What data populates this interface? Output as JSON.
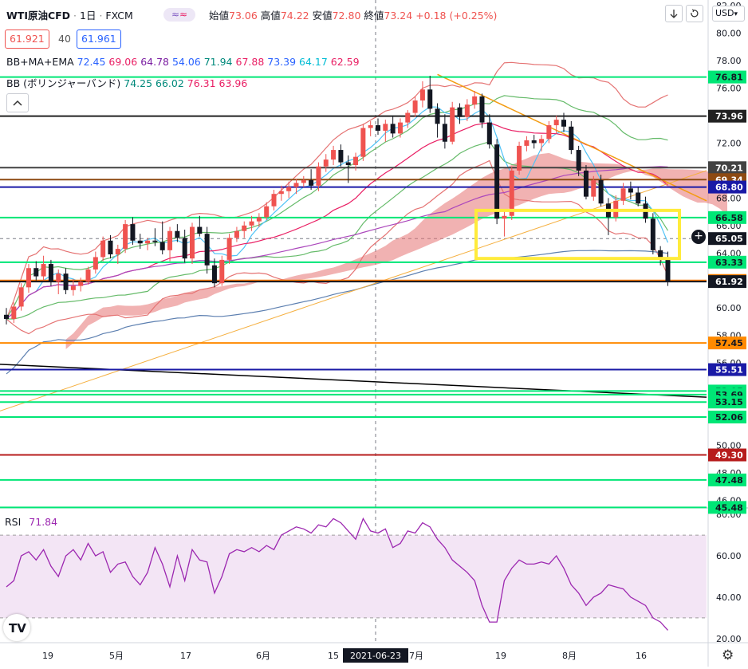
{
  "header": {
    "symbol": "WTI原油CFD",
    "interval": "1日",
    "source": "FXCM",
    "ohlc_labels": [
      "始値",
      "高値",
      "安値",
      "終値"
    ],
    "ohlc_values": [
      "73.06",
      "74.22",
      "72.80",
      "73.24"
    ],
    "change": "+0.18 (+0.25%)",
    "bid": "61.921",
    "spread": "40",
    "ask": "61.961",
    "currency": "USD"
  },
  "indicators": {
    "bbmaema_name": "BB+MA+EMA",
    "bbmaema_values": [
      "72.45",
      "69.06",
      "64.78",
      "54.06",
      "71.94",
      "67.88",
      "73.39",
      "64.17",
      "62.59"
    ],
    "bbmaema_colors": [
      "#2962ff",
      "#e91e63",
      "#7b1fa2",
      "#2962ff",
      "#00897b",
      "#e91e63",
      "#2962ff",
      "#00bcd4",
      "#e91e63"
    ],
    "bb_name": "BB (ボリンジャーバンド)",
    "bb_values": [
      "74.25",
      "66.02",
      "76.31",
      "63.96"
    ],
    "bb_colors": [
      "#00897b",
      "#00897b",
      "#e91e63",
      "#e91e63"
    ],
    "rsi_name": "RSI",
    "rsi_value": "71.84"
  },
  "colors": {
    "up": "#ef5350",
    "down": "#131722",
    "cloud": "#e57373",
    "cloud_dark": "#546e7a",
    "rsi_line": "#9c27b0",
    "rsi_band": "#f3e5f5",
    "highlight": "#ffeb3b"
  },
  "icons": [
    "collapse-icon",
    "scroll-down-icon",
    "fullscreen-icon",
    "settings-icon",
    "tradingview-logo",
    "crosshair-plus-icon"
  ],
  "chart_data": [
    {
      "type": "candlestick",
      "x_axis": {
        "tick_labels": [
          "19",
          "5月",
          "17",
          "6月",
          "15",
          "7月",
          "19",
          "8月",
          "16"
        ],
        "highlighted_date": "2021-06-23"
      },
      "y_axis": {
        "side": "right",
        "ylim": [
          45.5,
          82.3
        ],
        "tick_labels": [
          "82.00",
          "80.00",
          "78.00",
          "76.00",
          "74.00",
          "72.00",
          "70.00",
          "68.00",
          "66.00",
          "64.00",
          "62.00",
          "60.00",
          "58.00",
          "56.00",
          "54.00",
          "52.00",
          "50.00",
          "48.00",
          "46.00"
        ],
        "current_price": "65.05"
      },
      "candles": [
        {
          "o": 59.5,
          "h": 60.0,
          "l": 58.8,
          "c": 59.2
        },
        {
          "o": 59.2,
          "h": 60.4,
          "l": 58.9,
          "c": 60.1
        },
        {
          "o": 60.1,
          "h": 61.8,
          "l": 59.8,
          "c": 61.5
        },
        {
          "o": 61.5,
          "h": 63.2,
          "l": 61.1,
          "c": 62.9
        },
        {
          "o": 62.9,
          "h": 63.4,
          "l": 62.0,
          "c": 62.3
        },
        {
          "o": 62.3,
          "h": 63.8,
          "l": 62.0,
          "c": 63.2
        },
        {
          "o": 63.2,
          "h": 63.5,
          "l": 61.6,
          "c": 61.9
        },
        {
          "o": 61.9,
          "h": 62.8,
          "l": 61.0,
          "c": 62.5
        },
        {
          "o": 62.5,
          "h": 62.9,
          "l": 61.0,
          "c": 61.3
        },
        {
          "o": 61.3,
          "h": 62.1,
          "l": 60.9,
          "c": 61.6
        },
        {
          "o": 61.6,
          "h": 62.2,
          "l": 61.2,
          "c": 61.9
        },
        {
          "o": 61.9,
          "h": 63.0,
          "l": 61.7,
          "c": 62.8
        },
        {
          "o": 62.8,
          "h": 64.1,
          "l": 62.5,
          "c": 63.7
        },
        {
          "o": 63.7,
          "h": 65.2,
          "l": 63.4,
          "c": 64.9
        },
        {
          "o": 64.9,
          "h": 65.3,
          "l": 63.6,
          "c": 63.9
        },
        {
          "o": 63.9,
          "h": 64.6,
          "l": 63.2,
          "c": 64.3
        },
        {
          "o": 64.3,
          "h": 66.4,
          "l": 64.0,
          "c": 66.1
        },
        {
          "o": 66.1,
          "h": 66.6,
          "l": 64.6,
          "c": 64.9
        },
        {
          "o": 64.9,
          "h": 65.4,
          "l": 64.3,
          "c": 64.7
        },
        {
          "o": 64.7,
          "h": 65.1,
          "l": 64.2,
          "c": 64.9
        },
        {
          "o": 64.9,
          "h": 65.8,
          "l": 64.5,
          "c": 64.8
        },
        {
          "o": 64.8,
          "h": 66.3,
          "l": 63.9,
          "c": 64.2
        },
        {
          "o": 64.2,
          "h": 65.9,
          "l": 63.4,
          "c": 65.6
        },
        {
          "o": 65.6,
          "h": 66.1,
          "l": 64.8,
          "c": 65.1
        },
        {
          "o": 65.1,
          "h": 65.7,
          "l": 63.3,
          "c": 63.6
        },
        {
          "o": 63.6,
          "h": 66.2,
          "l": 63.2,
          "c": 65.9
        },
        {
          "o": 65.9,
          "h": 66.7,
          "l": 65.2,
          "c": 65.4
        },
        {
          "o": 65.4,
          "h": 65.9,
          "l": 62.5,
          "c": 63.1
        },
        {
          "o": 63.1,
          "h": 63.6,
          "l": 61.5,
          "c": 61.8
        },
        {
          "o": 61.8,
          "h": 63.8,
          "l": 61.6,
          "c": 63.5
        },
        {
          "o": 63.5,
          "h": 65.4,
          "l": 63.2,
          "c": 65.1
        },
        {
          "o": 65.1,
          "h": 65.9,
          "l": 64.8,
          "c": 65.6
        },
        {
          "o": 65.6,
          "h": 66.3,
          "l": 65.1,
          "c": 66.0
        },
        {
          "o": 66.0,
          "h": 66.7,
          "l": 65.6,
          "c": 66.3
        },
        {
          "o": 66.3,
          "h": 66.9,
          "l": 65.9,
          "c": 66.6
        },
        {
          "o": 66.6,
          "h": 67.7,
          "l": 66.4,
          "c": 67.4
        },
        {
          "o": 67.4,
          "h": 68.6,
          "l": 67.1,
          "c": 68.3
        },
        {
          "o": 68.3,
          "h": 68.9,
          "l": 67.8,
          "c": 68.5
        },
        {
          "o": 68.5,
          "h": 69.2,
          "l": 68.0,
          "c": 68.8
        },
        {
          "o": 68.8,
          "h": 69.4,
          "l": 68.3,
          "c": 69.1
        },
        {
          "o": 69.1,
          "h": 69.6,
          "l": 68.8,
          "c": 69.3
        },
        {
          "o": 69.3,
          "h": 70.1,
          "l": 68.6,
          "c": 68.9
        },
        {
          "o": 68.9,
          "h": 70.6,
          "l": 68.5,
          "c": 70.3
        },
        {
          "o": 70.3,
          "h": 71.2,
          "l": 69.9,
          "c": 70.8
        },
        {
          "o": 70.8,
          "h": 71.8,
          "l": 70.4,
          "c": 71.5
        },
        {
          "o": 71.5,
          "h": 71.9,
          "l": 70.3,
          "c": 70.6
        },
        {
          "o": 70.6,
          "h": 71.1,
          "l": 69.1,
          "c": 70.4
        },
        {
          "o": 70.4,
          "h": 71.3,
          "l": 70.0,
          "c": 71.0
        },
        {
          "o": 71.0,
          "h": 73.4,
          "l": 70.7,
          "c": 73.1
        },
        {
          "o": 73.1,
          "h": 73.6,
          "l": 72.5,
          "c": 73.3
        },
        {
          "o": 73.3,
          "h": 73.8,
          "l": 72.6,
          "c": 72.9
        },
        {
          "o": 72.9,
          "h": 73.7,
          "l": 72.1,
          "c": 73.4
        },
        {
          "o": 73.4,
          "h": 74.0,
          "l": 72.4,
          "c": 72.7
        },
        {
          "o": 72.7,
          "h": 73.8,
          "l": 72.4,
          "c": 73.5
        },
        {
          "o": 73.5,
          "h": 74.4,
          "l": 73.1,
          "c": 74.2
        },
        {
          "o": 74.2,
          "h": 75.4,
          "l": 73.9,
          "c": 75.1
        },
        {
          "o": 75.1,
          "h": 76.5,
          "l": 74.6,
          "c": 75.9
        },
        {
          "o": 75.9,
          "h": 76.9,
          "l": 74.2,
          "c": 74.5
        },
        {
          "o": 74.5,
          "h": 74.9,
          "l": 72.4,
          "c": 73.4
        },
        {
          "o": 73.4,
          "h": 74.1,
          "l": 71.6,
          "c": 72.1
        },
        {
          "o": 72.1,
          "h": 75.0,
          "l": 71.9,
          "c": 74.6
        },
        {
          "o": 74.6,
          "h": 74.9,
          "l": 73.4,
          "c": 73.9
        },
        {
          "o": 73.9,
          "h": 75.2,
          "l": 73.6,
          "c": 74.8
        },
        {
          "o": 74.8,
          "h": 75.8,
          "l": 74.5,
          "c": 75.4
        },
        {
          "o": 75.4,
          "h": 75.6,
          "l": 73.1,
          "c": 73.5
        },
        {
          "o": 73.5,
          "h": 74.1,
          "l": 71.6,
          "c": 71.9
        },
        {
          "o": 71.9,
          "h": 72.3,
          "l": 66.1,
          "c": 66.5
        },
        {
          "o": 66.5,
          "h": 67.1,
          "l": 65.2,
          "c": 66.7
        },
        {
          "o": 66.7,
          "h": 70.3,
          "l": 66.4,
          "c": 70.0
        },
        {
          "o": 70.0,
          "h": 72.1,
          "l": 69.7,
          "c": 71.8
        },
        {
          "o": 71.8,
          "h": 72.5,
          "l": 71.4,
          "c": 72.2
        },
        {
          "o": 72.2,
          "h": 72.6,
          "l": 71.6,
          "c": 72.0
        },
        {
          "o": 72.0,
          "h": 72.6,
          "l": 71.4,
          "c": 72.3
        },
        {
          "o": 72.3,
          "h": 73.6,
          "l": 72.0,
          "c": 73.3
        },
        {
          "o": 73.3,
          "h": 74.0,
          "l": 72.7,
          "c": 73.7
        },
        {
          "o": 73.7,
          "h": 74.2,
          "l": 72.8,
          "c": 73.2
        },
        {
          "o": 73.2,
          "h": 73.6,
          "l": 71.2,
          "c": 71.5
        },
        {
          "o": 71.5,
          "h": 71.8,
          "l": 69.6,
          "c": 70.0
        },
        {
          "o": 70.0,
          "h": 70.4,
          "l": 67.9,
          "c": 68.1
        },
        {
          "o": 68.1,
          "h": 69.6,
          "l": 67.8,
          "c": 69.3
        },
        {
          "o": 69.3,
          "h": 69.7,
          "l": 67.4,
          "c": 67.6
        },
        {
          "o": 67.6,
          "h": 68.0,
          "l": 65.3,
          "c": 66.6
        },
        {
          "o": 66.6,
          "h": 68.2,
          "l": 66.3,
          "c": 67.8
        },
        {
          "o": 67.8,
          "h": 69.1,
          "l": 67.5,
          "c": 68.7
        },
        {
          "o": 68.7,
          "h": 69.2,
          "l": 67.9,
          "c": 68.4
        },
        {
          "o": 68.4,
          "h": 68.8,
          "l": 67.4,
          "c": 67.6
        },
        {
          "o": 67.6,
          "h": 68.1,
          "l": 66.2,
          "c": 66.5
        },
        {
          "o": 66.5,
          "h": 66.9,
          "l": 63.9,
          "c": 64.2
        },
        {
          "o": 64.2,
          "h": 64.5,
          "l": 63.1,
          "c": 63.6
        },
        {
          "o": 63.6,
          "h": 64.1,
          "l": 61.6,
          "c": 61.9
        }
      ],
      "horizontal_levels": [
        {
          "price": 76.81,
          "label": "76.81",
          "color": "#00e676"
        },
        {
          "price": 73.96,
          "label": "73.96",
          "color": "#212121"
        },
        {
          "price": 70.21,
          "label": "70.21",
          "color": "#424242"
        },
        {
          "price": 69.34,
          "label": "69.34",
          "color": "#8d4a12"
        },
        {
          "price": 68.8,
          "label": "68.80",
          "color": "#1a1aa6"
        },
        {
          "price": 66.58,
          "label": "66.58",
          "color": "#00e676"
        },
        {
          "price": 63.33,
          "label": "63.33",
          "color": "#00e676"
        },
        {
          "price": 62.0,
          "label": "62.00",
          "color": "#ff7b00"
        },
        {
          "price": 61.92,
          "label": "61.92",
          "color": "#131722"
        },
        {
          "price": 57.45,
          "label": "57.45",
          "color": "#ff8a00"
        },
        {
          "price": 55.51,
          "label": "55.51",
          "color": "#1a1aa6"
        },
        {
          "price": 53.95,
          "label": "53.95",
          "color": "#00e676"
        },
        {
          "price": 53.69,
          "label": "53.69",
          "color": "#00e676"
        },
        {
          "price": 53.15,
          "label": "53.15",
          "color": "#00e676"
        },
        {
          "price": 52.06,
          "label": "52.06",
          "color": "#00e676"
        },
        {
          "price": 49.3,
          "label": "49.30",
          "color": "#b71c1c"
        },
        {
          "price": 47.48,
          "label": "47.48",
          "color": "#00e676"
        },
        {
          "price": 45.48,
          "label": "45.48",
          "color": "#00e676"
        }
      ],
      "highlight_box": {
        "price_low": 63.6,
        "price_high": 67.1
      }
    },
    {
      "type": "line",
      "name": "RSI",
      "ylim": [
        18,
        82
      ],
      "tick_labels": [
        "80.00",
        "60.00",
        "40.00",
        "20.00"
      ],
      "band": [
        30,
        70
      ],
      "values": [
        45,
        48,
        60,
        62,
        58,
        63,
        55,
        50,
        60,
        63,
        58,
        66,
        60,
        62,
        52,
        56,
        57,
        50,
        46,
        52,
        64,
        56,
        45,
        60,
        48,
        63,
        58,
        57,
        42,
        50,
        61,
        63,
        62,
        64,
        62,
        65,
        63,
        70,
        72,
        74,
        73,
        71,
        75,
        74,
        78,
        76,
        72,
        68,
        78,
        72,
        71,
        73,
        64,
        66,
        72,
        71,
        76,
        74,
        68,
        64,
        58,
        55,
        52,
        48,
        36,
        28,
        28,
        48,
        54,
        58,
        56,
        56,
        57,
        56,
        60,
        54,
        46,
        42,
        36,
        40,
        42,
        46,
        45,
        44,
        40,
        38,
        36,
        30,
        28,
        24
      ]
    }
  ]
}
